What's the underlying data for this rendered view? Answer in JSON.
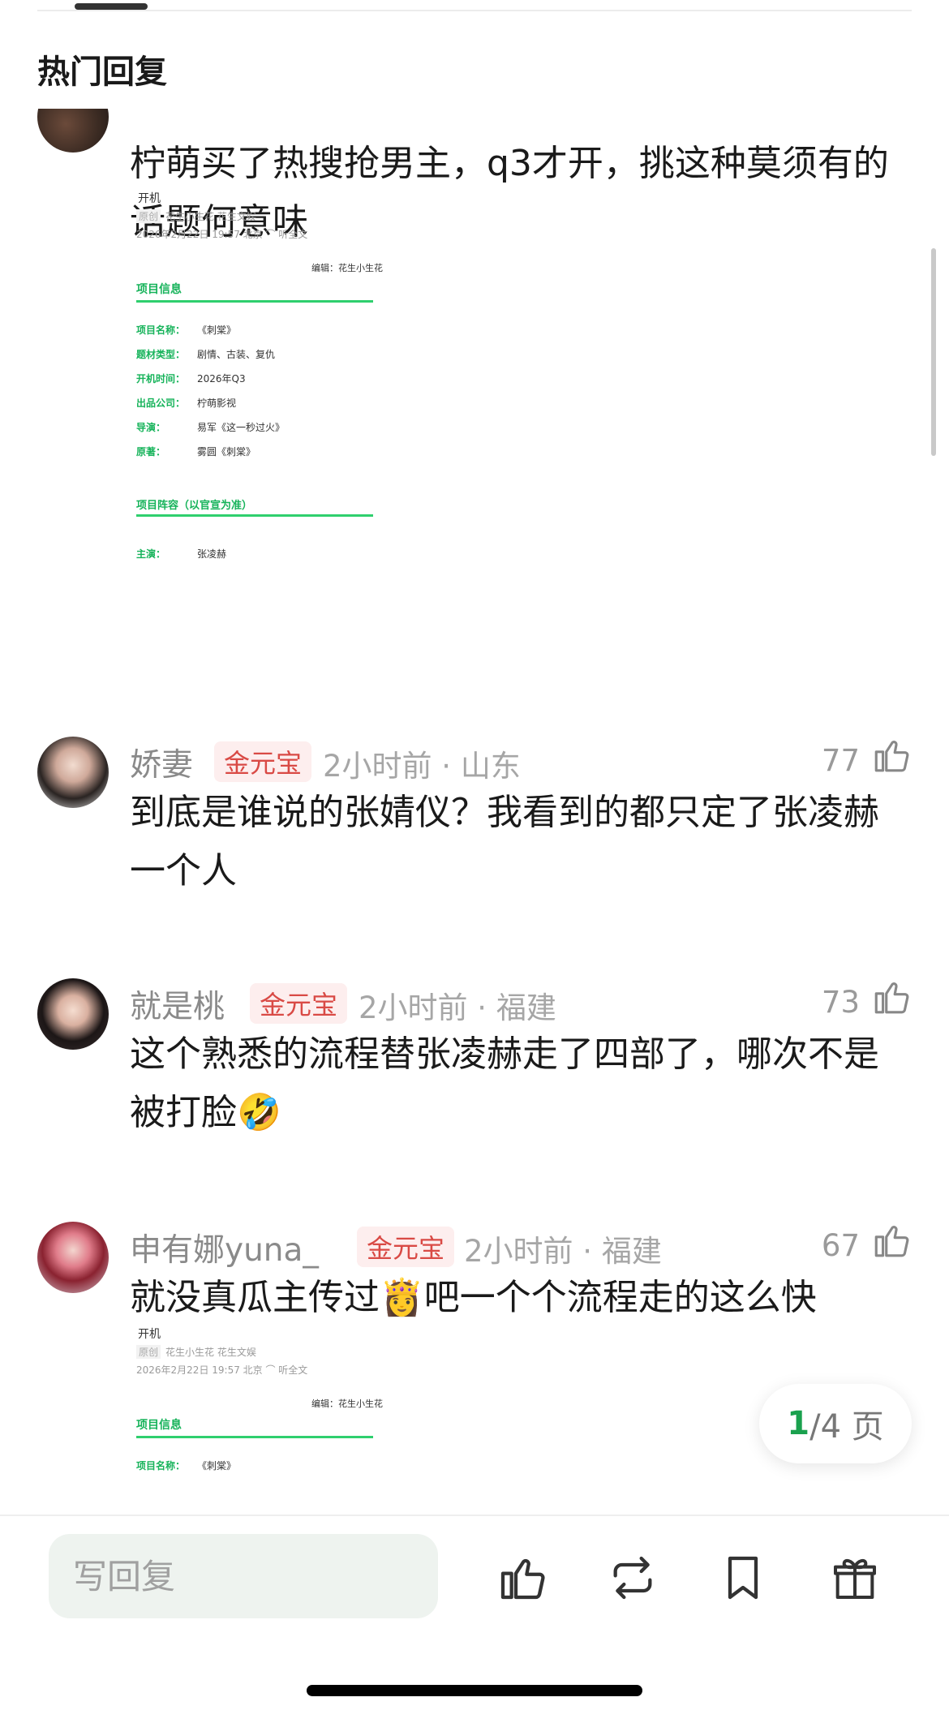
{
  "section_title": "热门回复",
  "pager": {
    "current": "1",
    "rest": "/4 页"
  },
  "reply_placeholder": "写回复",
  "comments": [
    {
      "text": "柠萌买了热搜抢男主，q3才开，挑这种莫须有的话题何意味",
      "doc": {
        "top_fragment": "开机",
        "tag": "原创",
        "source": "花生小生花  花生文娱",
        "date": "2026年2月22日 19:57  北京  ⌒ 听全文",
        "editor": "编辑：花生小生花",
        "section1": "项目信息",
        "rows": [
          {
            "k": "项目名称：",
            "v": "《刺棠》"
          },
          {
            "k": "题材类型：",
            "v": "剧情、古装、复仇"
          },
          {
            "k": "开机时间：",
            "v": "2026年Q3"
          },
          {
            "k": "出品公司：",
            "v": "柠萌影视"
          },
          {
            "k": "导演：",
            "v": "易军《这一秒过火》"
          },
          {
            "k": "原著：",
            "v": "雾圆《刺棠》"
          }
        ],
        "section2": "项目阵容（以官宣为准）",
        "lead_k": "主演：",
        "lead_v": "张凌赫"
      }
    },
    {
      "author": "娇妻",
      "badge": "金元宝",
      "meta": "2小时前 · 山东",
      "likes": "77",
      "text": "到底是谁说的张婧仪？我看到的都只定了张凌赫一个人"
    },
    {
      "author": "就是桃",
      "badge": "金元宝",
      "meta": "2小时前 · 福建",
      "likes": "73",
      "text": "这个熟悉的流程替张凌赫走了四部了，哪次不是被打脸🤣"
    },
    {
      "author": "申有娜yuna_",
      "badge": "金元宝",
      "meta": "2小时前 · 福建",
      "likes": "67",
      "text": "就没真瓜主传过👸吧一个个流程走的这么快",
      "doc": {
        "top_fragment": "开机",
        "tag": "原创",
        "source": "花生小生花  花生文娱",
        "date": "2026年2月22日 19:57  北京  ⌒ 听全文",
        "editor": "编辑：花生小生花",
        "section1": "项目信息",
        "row1_k": "项目名称：",
        "row1_v": "《刺棠》"
      }
    }
  ],
  "colors": {
    "accent": "#1aa14e",
    "badge": "#d94a45",
    "doc_green": "#16b35a"
  }
}
